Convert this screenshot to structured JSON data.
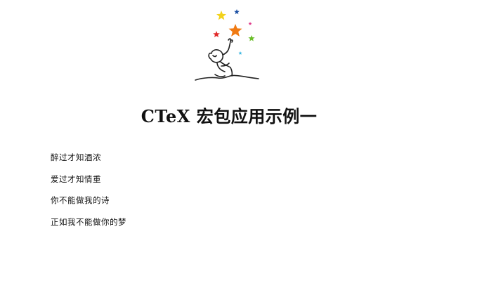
{
  "document": {
    "logo": {
      "icon": "child-reaching-stars-logo",
      "star_colors": [
        "#f2d21b",
        "#1a4fa3",
        "#e03a8a",
        "#e12a2a",
        "#f07a12",
        "#6bbf2a",
        "#3ab6e0"
      ]
    },
    "title": "CTeX 宏包应用示例一",
    "lines": [
      "醉过才知酒浓",
      "爱过才知情重",
      "你不能做我的诗",
      "正如我不能做你的梦"
    ]
  }
}
